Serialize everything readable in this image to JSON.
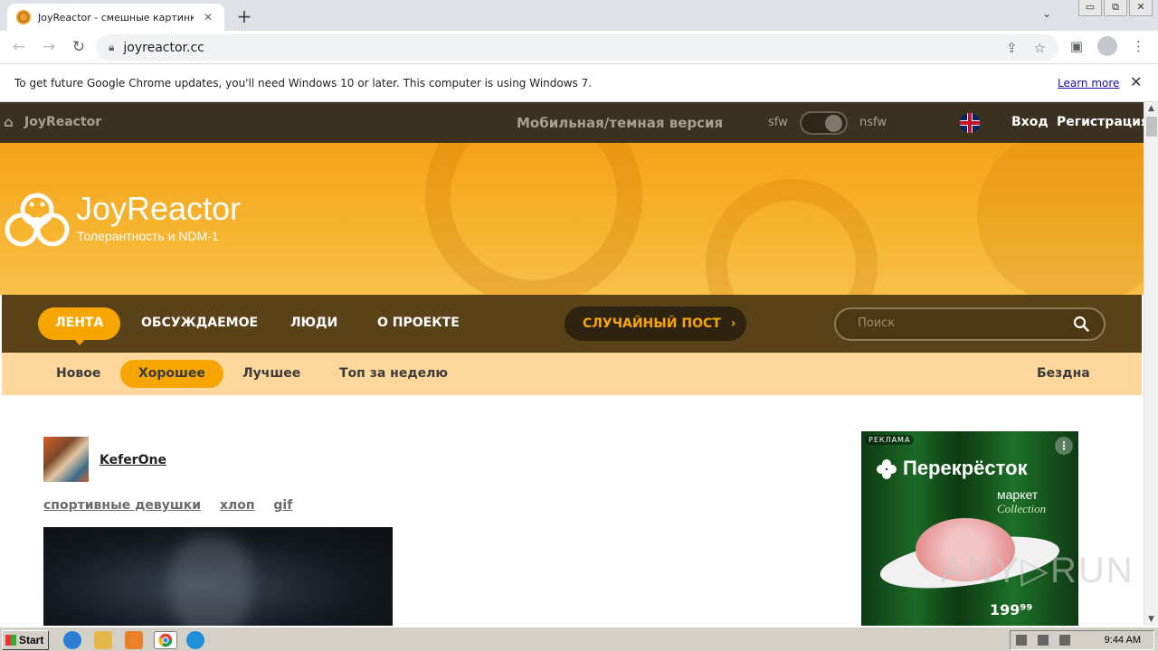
{
  "browser": {
    "tab_title": "JoyReactor - смешные картинки и",
    "tab_close": "✕",
    "new_tab": "+",
    "tab_menu": "⌄",
    "url": "joyreactor.cc",
    "window_controls": [
      "▭",
      "⧉",
      "✕"
    ]
  },
  "infobar": {
    "message": "To get future Google Chrome updates, you'll need Windows 10 or later. This computer is using Windows 7.",
    "link": "Learn more",
    "close": "✕"
  },
  "site_bar": {
    "brand": "JoyReactor",
    "mobile_link": "Мобильная/темная версия",
    "sfw": "sfw",
    "nsfw": "nsfw",
    "login": "Вход",
    "register": "Регистрация"
  },
  "banner": {
    "logo_text": "JoyReactor",
    "tagline": "Толерантность и NDM-1"
  },
  "main_nav": {
    "items": [
      "ЛЕНТА",
      "ОБСУЖДАЕМОЕ",
      "ЛЮДИ",
      "О ПРОЕКТЕ"
    ],
    "active_index": 0,
    "random_post": "СЛУЧАЙНЫЙ ПОСТ",
    "random_arrow": "›",
    "search_placeholder": "Поиск"
  },
  "sub_nav": {
    "items": [
      "Новое",
      "Хорошее",
      "Лучшее",
      "Топ за неделю"
    ],
    "active_index": 1,
    "abyss": "Бездна"
  },
  "post": {
    "author": "KeferOne",
    "tags": [
      "спортивные девушки",
      "хлоп",
      "gif"
    ]
  },
  "ad": {
    "label": "РЕКЛАМА",
    "menu": "⋮",
    "brand": "Перекрёсток",
    "market": "маркет",
    "collection": "Collection",
    "price": "199⁹⁹"
  },
  "watermark": "ANY▷RUN",
  "taskbar": {
    "start": "Start",
    "time": "9:44 AM"
  },
  "colors": {
    "site_bar": "#3a3120",
    "banner": "#f4a21a",
    "main_nav": "#5a4218",
    "accent": "#f7a600",
    "sub_nav": "#fdd79b"
  }
}
